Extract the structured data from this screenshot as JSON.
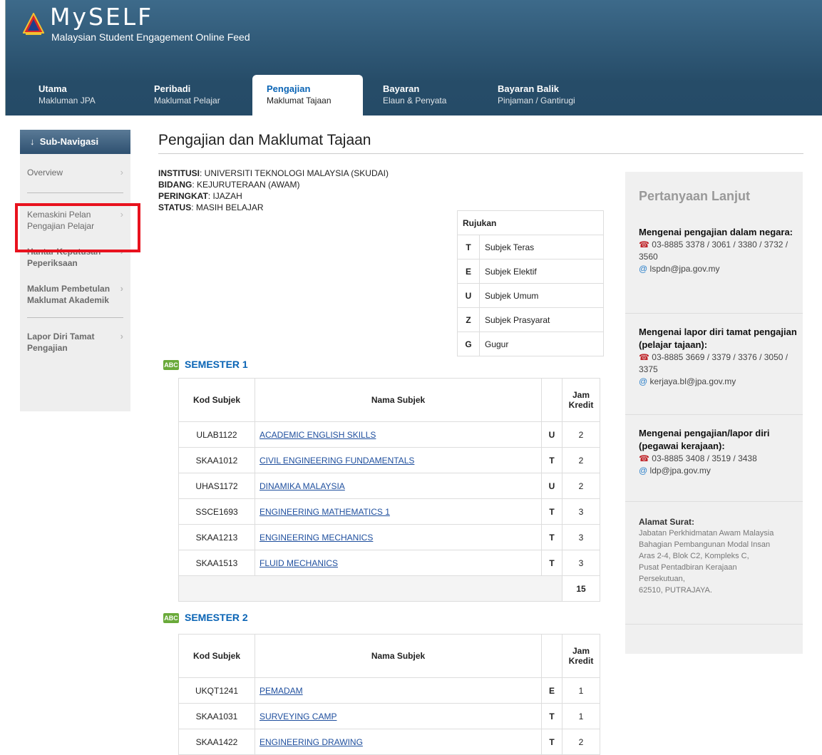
{
  "brand": {
    "title": "MySELF",
    "subtitle": "Malaysian Student Engagement Online Feed"
  },
  "topnav": [
    {
      "main": "Utama",
      "sub": "Makluman JPA"
    },
    {
      "main": "Peribadi",
      "sub": "Maklumat Pelajar"
    },
    {
      "main": "Pengajian",
      "sub": "Maklumat Tajaan"
    },
    {
      "main": "Bayaran",
      "sub": "Elaun & Penyata"
    },
    {
      "main": "Bayaran Balik",
      "sub": "Pinjaman / Gantirugi"
    }
  ],
  "sidebar": {
    "header": "Sub-Navigasi",
    "items": [
      {
        "label": "Overview"
      },
      {
        "label": "Kemaskini Pelan Pengajian Pelajar"
      },
      {
        "label": "Hantar Keputusan Peperiksaan"
      },
      {
        "label": "Maklum Pembetulan Maklumat Akademik"
      },
      {
        "label": "Lapor Diri Tamat Pengajian"
      }
    ],
    "chevron": "›"
  },
  "page": {
    "title": "Pengajian dan Maklumat Tajaan",
    "info": {
      "institusi_label": "INSTITUSI",
      "institusi": ": UNIVERSITI TEKNOLOGI MALAYSIA (SKUDAI)",
      "bidang_label": "BIDANG",
      "bidang": ": KEJURUTERAAN (AWAM)",
      "peringkat_label": "PERINGKAT",
      "peringkat": ": IJAZAH",
      "status_label": "STATUS",
      "status": ": MASIH BELAJAR"
    }
  },
  "rujukan": {
    "header": "Rujukan",
    "rows": [
      {
        "code": "T",
        "label": "Subjek Teras"
      },
      {
        "code": "E",
        "label": "Subjek Elektif"
      },
      {
        "code": "U",
        "label": "Subjek Umum"
      },
      {
        "code": "Z",
        "label": "Subjek Prasyarat"
      },
      {
        "code": "G",
        "label": "Gugur"
      }
    ]
  },
  "table_headers": {
    "kod": "Kod Subjek",
    "nama": "Nama Subjek",
    "jam": "Jam Kredit"
  },
  "semesters": [
    {
      "title": "SEMESTER 1",
      "icon": "ABC",
      "rows": [
        {
          "kod": "ULAB1122",
          "nama": "ACADEMIC ENGLISH SKILLS",
          "type": "U",
          "jam": "2"
        },
        {
          "kod": "SKAA1012",
          "nama": "CIVIL ENGINEERING FUNDAMENTALS",
          "type": "T",
          "jam": "2"
        },
        {
          "kod": "UHAS1172",
          "nama": "DINAMIKA MALAYSIA",
          "type": "U",
          "jam": "2"
        },
        {
          "kod": "SSCE1693",
          "nama": "ENGINEERING MATHEMATICS 1",
          "type": "T",
          "jam": "3"
        },
        {
          "kod": "SKAA1213",
          "nama": "ENGINEERING MECHANICS",
          "type": "T",
          "jam": "3"
        },
        {
          "kod": "SKAA1513",
          "nama": "FLUID MECHANICS",
          "type": "T",
          "jam": "3"
        }
      ],
      "total": "15"
    },
    {
      "title": "SEMESTER 2",
      "icon": "ABC",
      "rows": [
        {
          "kod": "UKQT1241",
          "nama": "PEMADAM",
          "type": "E",
          "jam": "1"
        },
        {
          "kod": "SKAA1031",
          "nama": "SURVEYING CAMP",
          "type": "T",
          "jam": "1"
        },
        {
          "kod": "SKAA1422",
          "nama": "ENGINEERING DRAWING",
          "type": "T",
          "jam": "2"
        }
      ]
    }
  ],
  "right_panel": {
    "title": "Pertanyaan Lanjut",
    "contacts": [
      {
        "head": "Mengenai pengajian dalam negara:",
        "phone": "03-8885 3378 / 3061 / 3380 / 3732 / 3560",
        "email": "lspdn@jpa.gov.my"
      },
      {
        "head": "Mengenai lapor diri tamat pengajian (pelajar tajaan):",
        "phone": "03-8885 3669 / 3379 / 3376 / 3050 / 3375",
        "email": "kerjaya.bl@jpa.gov.my"
      },
      {
        "head": "Mengenai pengajian/lapor diri (pegawai kerajaan):",
        "phone": "03-8885 3408 / 3519 / 3438",
        "email": "ldp@jpa.gov.my"
      }
    ],
    "address": {
      "head": "Alamat Surat:",
      "lines": [
        "Jabatan Perkhidmatan Awam Malaysia",
        "Bahagian Pembangunan Modal Insan",
        "Aras 2-4, Blok C2, Kompleks C,",
        "Pusat Pentadbiran Kerajaan",
        "Persekutuan,",
        "62510, PUTRAJAYA."
      ]
    }
  },
  "colors": {
    "accent": "#0a64b5",
    "header": "#1d4260",
    "highlight": "#e8121e"
  }
}
